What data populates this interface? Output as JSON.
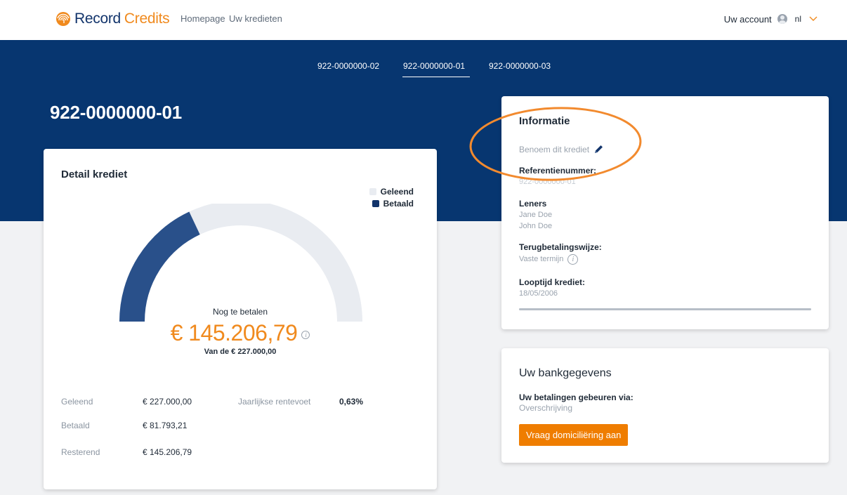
{
  "nav": {
    "brand_primary": "Record",
    "brand_secondary": "Credits",
    "links": [
      "Homepage",
      "Uw kredieten"
    ],
    "account_label": "Uw account",
    "language": "nl",
    "avatar_icon": "user-avatar-icon",
    "chevron_icon": "chevron-down-icon"
  },
  "credit_tabs": [
    "922-0000000-02",
    "922-0000000-01",
    "922-0000000-03"
  ],
  "active_tab": "922-0000000-01",
  "page_title": "922-0000000-01",
  "detail": {
    "title": "Detail krediet",
    "legend": [
      {
        "label": "Geleend",
        "color": "#e9ecf1"
      },
      {
        "label": "Betaald",
        "color": "#12346b"
      }
    ],
    "gauge": {
      "paid_fraction": 0.36,
      "track_color": "#e9ecf1",
      "fill_color": "#29508a"
    },
    "caption": "Nog te betalen",
    "amount": "€ 145.206,79",
    "info_icon": "info-icon",
    "sub": "Van de € 227.000,00",
    "summary": [
      {
        "label": "Geleend",
        "value": "€ 227.000,00"
      },
      {
        "label": "Betaald",
        "value": "€ 81.793,21"
      },
      {
        "label": "Resterend",
        "value": "€ 145.206,79"
      }
    ],
    "rate": {
      "label": "Jaarlijkse rentevoet",
      "value": "0,63%"
    }
  },
  "info": {
    "title": "Informatie",
    "rename_label": "Benoem dit krediet",
    "rename_icon": "pencil-icon",
    "reference_label": "Referentienummer:",
    "reference_value": "922-0000000-01",
    "borrowers_label": "Leners",
    "borrowers": [
      "Jane Doe",
      "John Doe"
    ],
    "repayment_label": "Terugbetalingswijze:",
    "repayment_value": "Vaste termijn",
    "term_label": "Looptijd krediet:",
    "term_value": "18/05/2006",
    "term_progress": 1.0
  },
  "bank": {
    "title": "Uw bankgegevens",
    "payments_label": "Uw betalingen gebeuren via:",
    "payments_value": "Overschrijving",
    "button_label": "Vraag domiciliëring aan"
  },
  "colors": {
    "navy": "#073670",
    "brand_orange": "#f08a1e",
    "button_orange": "#ef7d00",
    "annotation_orange": "#f28a2e"
  }
}
